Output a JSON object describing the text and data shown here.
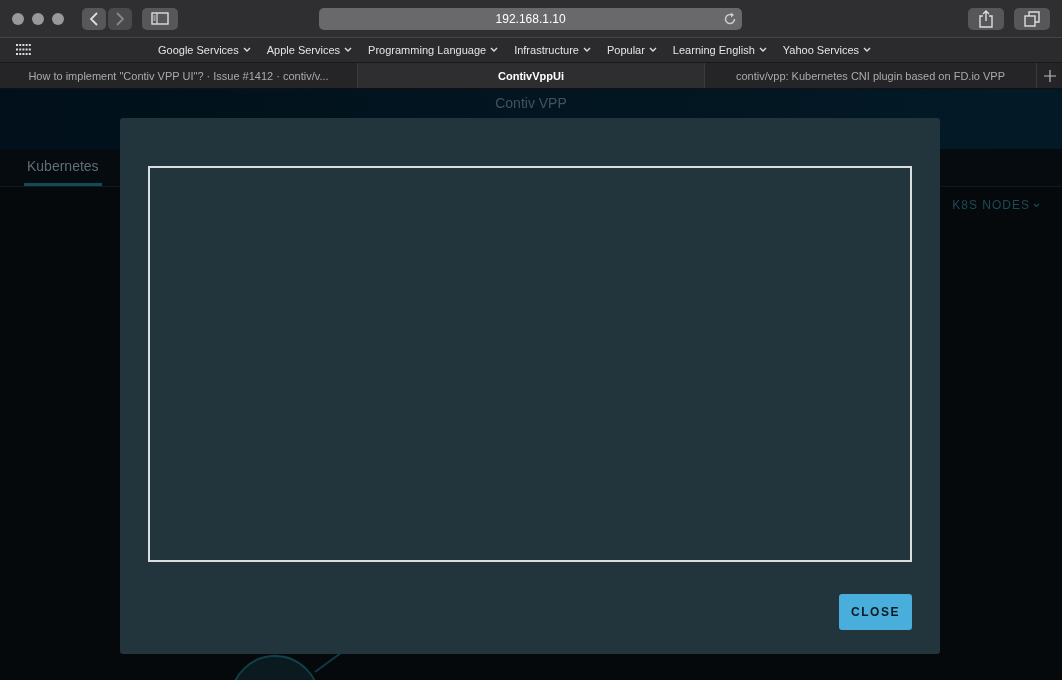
{
  "browser": {
    "address": "192.168.1.10",
    "bookmarks": [
      "Google Services",
      "Apple Services",
      "Programming Language",
      "Infrastructure",
      "Popular",
      "Learning English",
      "Yahoo Services"
    ],
    "tabs": [
      {
        "title": "How to implement \"Contiv VPP UI\"? · Issue #1412 · contiv/v...",
        "selected": false
      },
      {
        "title": "ContivVppUi",
        "selected": true
      },
      {
        "title": "contiv/vpp: Kubernetes CNI plugin based on FD.io VPP",
        "selected": false
      }
    ]
  },
  "app": {
    "title": "Contiv VPP",
    "nav_tabs": [
      {
        "label": "Kubernetes",
        "selected": true
      }
    ],
    "nodes_menu": "K8S NODES"
  },
  "modal": {
    "close_button": "CLOSE"
  }
}
